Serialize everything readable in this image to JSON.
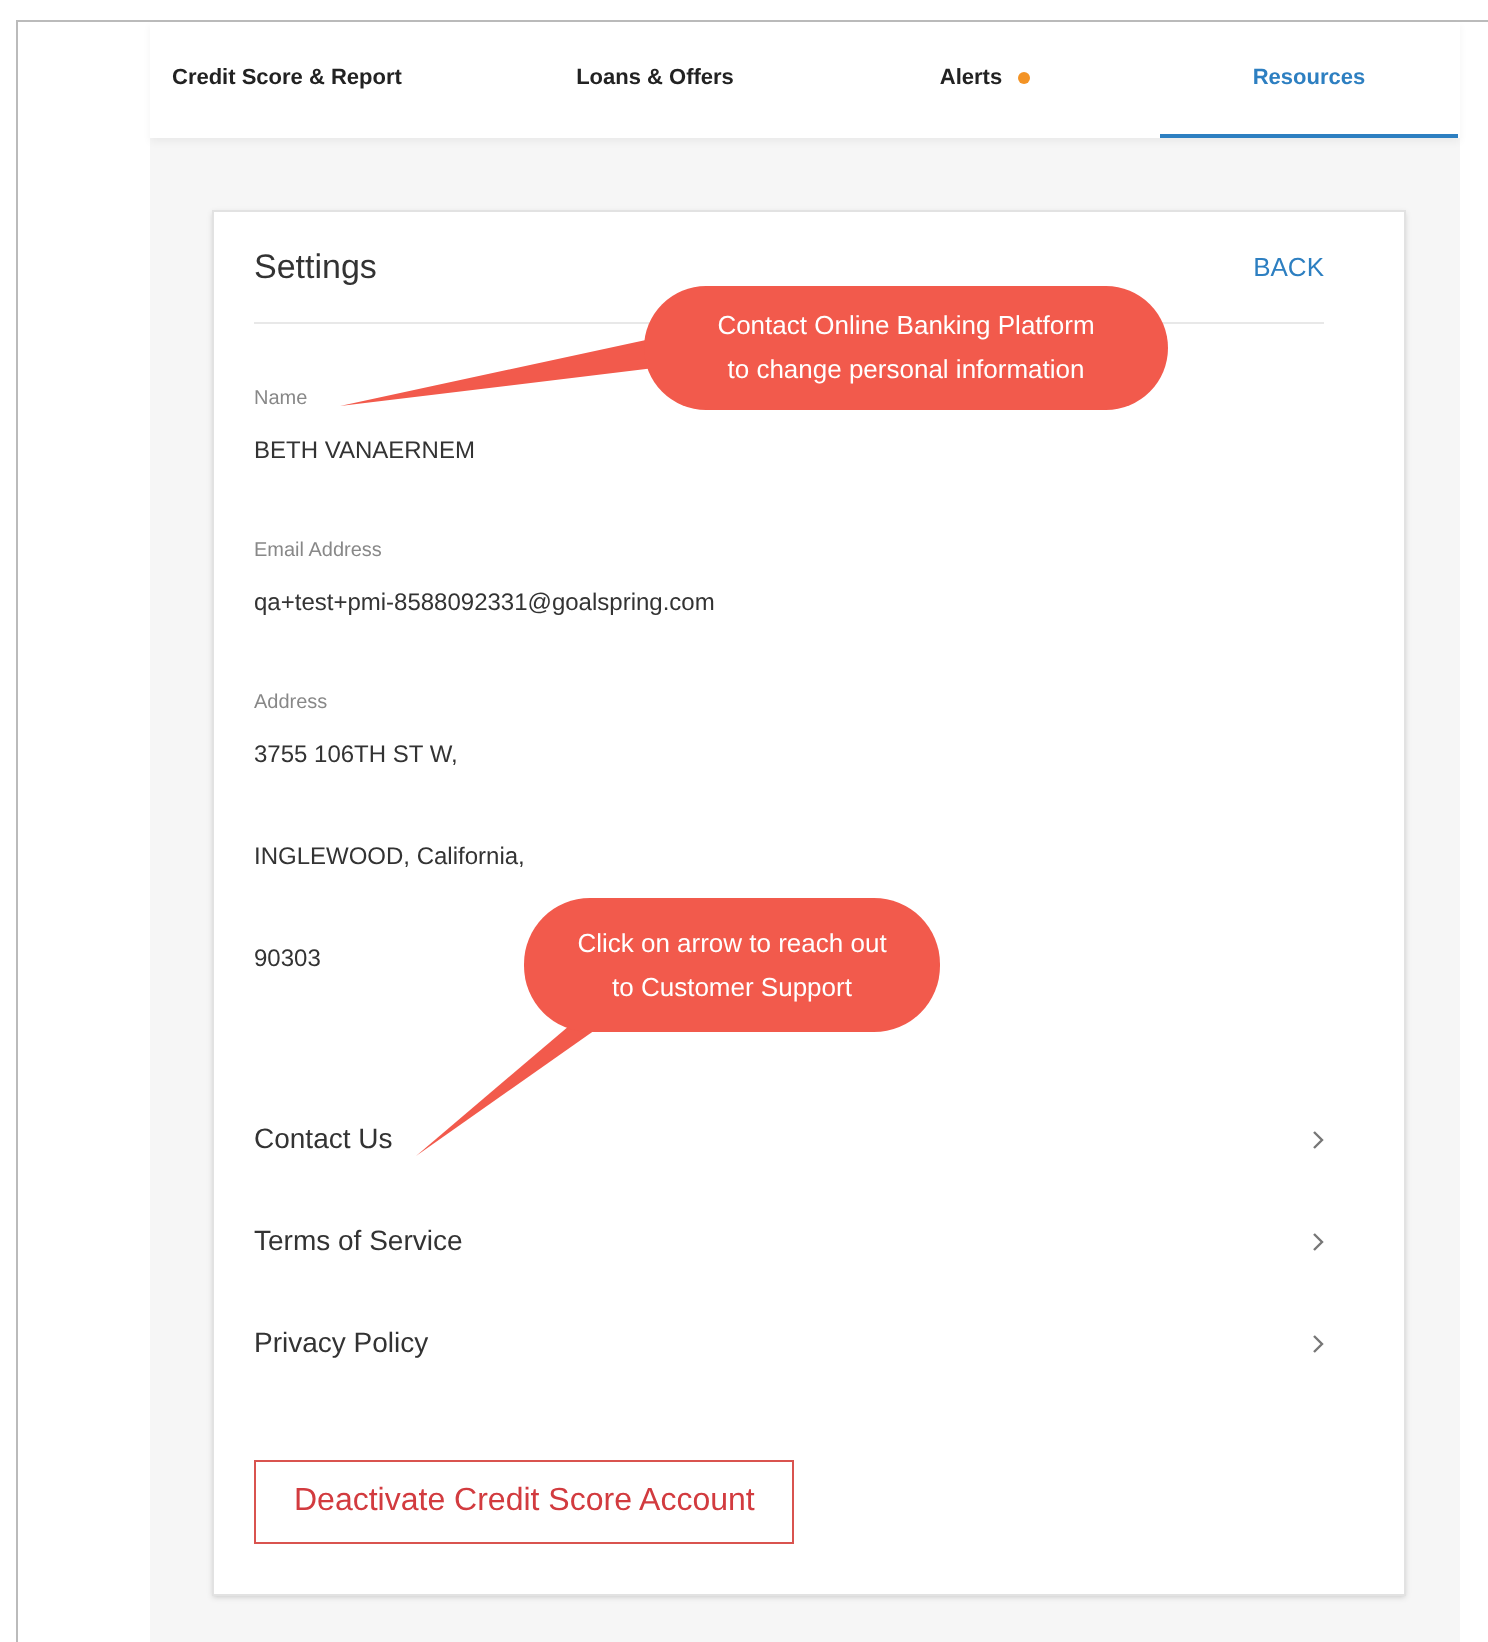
{
  "tabs": [
    {
      "label": "Credit Score & Report",
      "selected": false,
      "alert": false
    },
    {
      "label": "Loans & Offers",
      "selected": false,
      "alert": false
    },
    {
      "label": "Alerts",
      "selected": false,
      "alert": true
    },
    {
      "label": "Resources",
      "selected": true,
      "alert": false
    }
  ],
  "settings": {
    "title": "Settings",
    "back": "BACK",
    "fields": [
      {
        "label": "Name",
        "lines": [
          "BETH VANAERNEM"
        ]
      },
      {
        "label": "Email Address",
        "lines": [
          "qa+test+pmi-8588092331@goalspring.com"
        ]
      },
      {
        "label": "Address",
        "lines": [
          "3755 106TH ST W,",
          "INGLEWOOD, California,",
          "90303"
        ]
      }
    ],
    "links": [
      "Contact Us",
      "Terms of Service",
      "Privacy Policy"
    ],
    "deactivate": "Deactivate Credit Score Account"
  },
  "callouts": [
    {
      "lines": [
        "Contact Online Banking Platform",
        "to change personal information"
      ]
    },
    {
      "lines": [
        "Click on arrow to reach out",
        "to Customer Support"
      ]
    }
  ]
}
